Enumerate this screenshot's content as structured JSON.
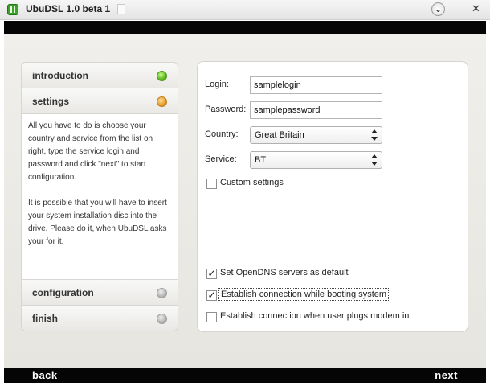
{
  "window": {
    "title": "UbuDSL 1.0 beta 1",
    "minimize_glyph": "⌄",
    "close_glyph": "✕"
  },
  "steps": [
    {
      "label": "introduction",
      "status": "done",
      "status_color": "#5bb51d"
    },
    {
      "label": "settings",
      "status": "current",
      "status_color": "#e39a25"
    },
    {
      "label": "configuration",
      "status": "pending",
      "status_color": "#b4b4b4"
    },
    {
      "label": "finish",
      "status": "pending",
      "status_color": "#b4b4b4"
    }
  ],
  "description": {
    "paragraph1": "All you have to do is choose your country and service from the list on right, type the service login and password and click \"next\" to start configuration.",
    "paragraph2": "It is possible that you will have to insert your system installation disc into the drive. Please do it, when UbuDSL asks your for it."
  },
  "form": {
    "login_label": "Login:",
    "login_value": "samplelogin",
    "password_label": "Password:",
    "password_value": "samplepassword",
    "country_label": "Country:",
    "country_value": "Great Britain",
    "service_label": "Service:",
    "service_value": "BT",
    "custom_settings_label": "Custom settings",
    "custom_settings_checked": false,
    "opendns_label": "Set OpenDNS servers as default",
    "opendns_checked": true,
    "boot_connect_label": "Establish connection while booting system",
    "boot_connect_checked": true,
    "plug_connect_label": "Establish connection when user plugs modem in",
    "plug_connect_checked": false,
    "check_glyph": "✓"
  },
  "footer": {
    "back_label": "back",
    "next_label": "next"
  }
}
